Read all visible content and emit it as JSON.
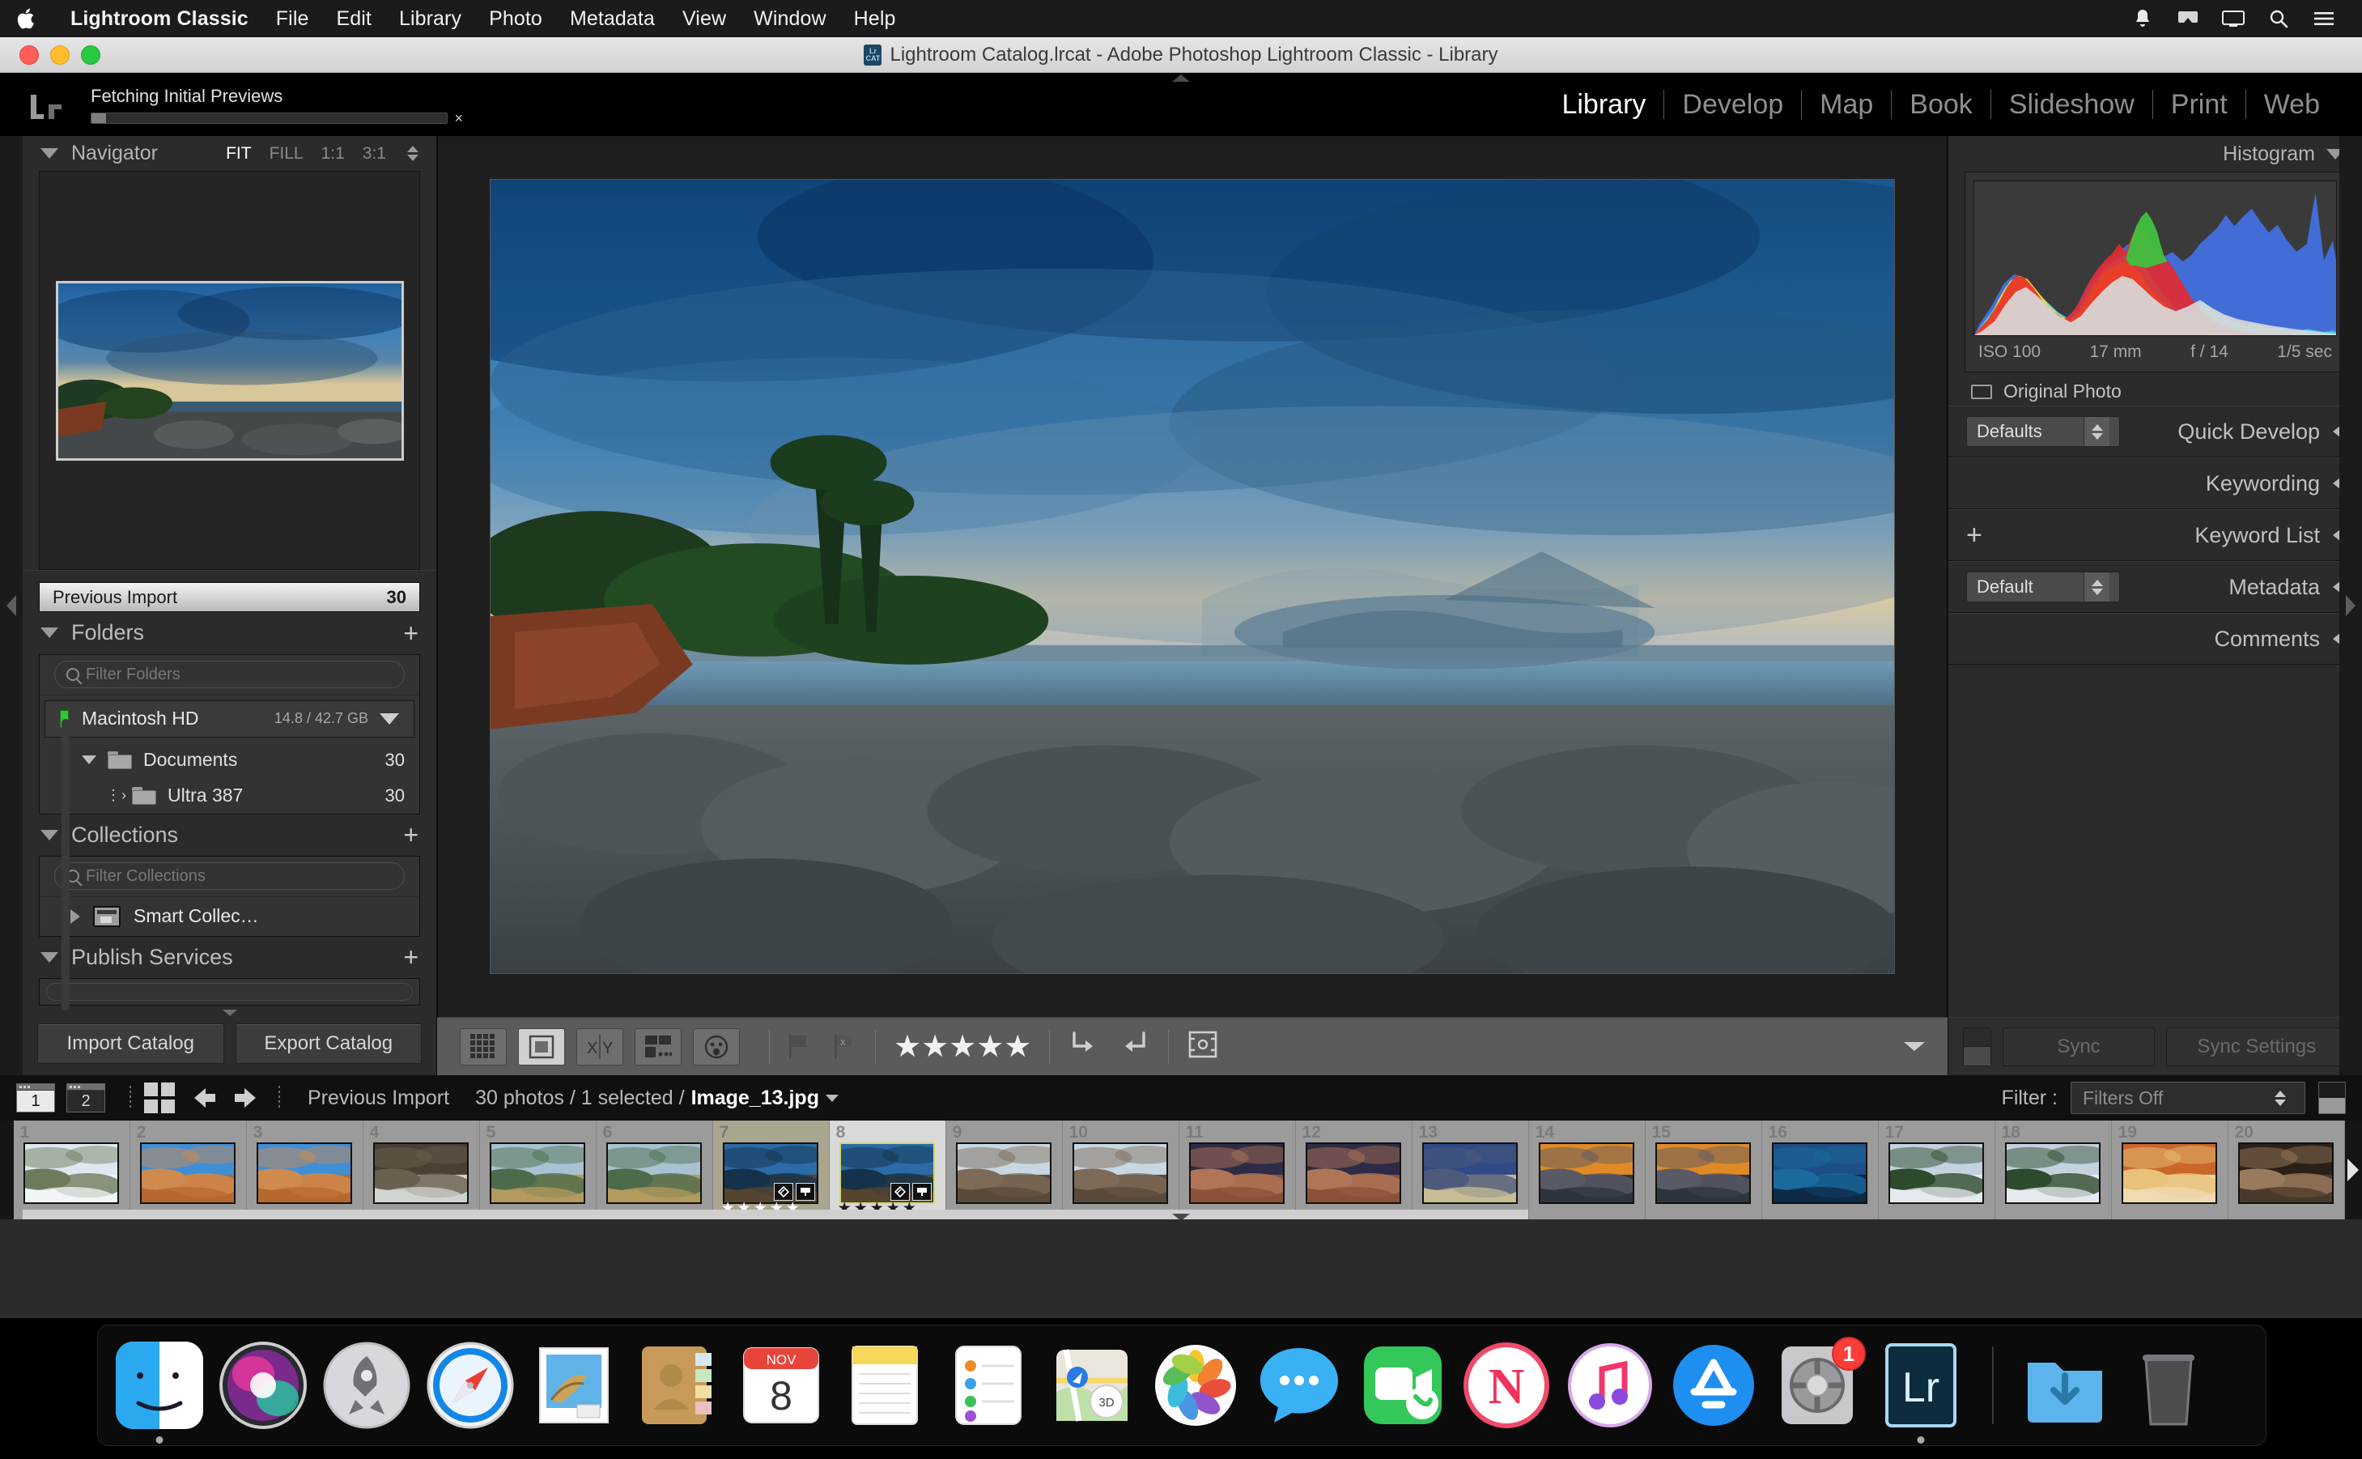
{
  "menubar": {
    "apple_icon": "apple-logo-icon",
    "items": [
      {
        "label": "Lightroom Classic",
        "bold": true
      },
      {
        "label": "File",
        "bold": false
      },
      {
        "label": "Edit",
        "bold": false
      },
      {
        "label": "Library",
        "bold": false
      },
      {
        "label": "Photo",
        "bold": false
      },
      {
        "label": "Metadata",
        "bold": false
      },
      {
        "label": "View",
        "bold": false
      },
      {
        "label": "Window",
        "bold": false
      },
      {
        "label": "Help",
        "bold": false
      }
    ],
    "status_icons": [
      "notification-bell-icon",
      "airplay-icon",
      "screen-share-icon",
      "search-icon",
      "control-center-icon"
    ]
  },
  "window": {
    "title": "Lightroom Catalog.lrcat - Adobe Photoshop Lightroom Classic - Library",
    "doc_icon_top": "Lr",
    "doc_icon_bottom": "CAT"
  },
  "topbar": {
    "app_logo": "Lr",
    "progress_label": "Fetching Initial Previews",
    "progress_percent": 4,
    "cancel_glyph": "×",
    "modules": [
      {
        "label": "Library",
        "active": true
      },
      {
        "label": "Develop",
        "active": false
      },
      {
        "label": "Map",
        "active": false
      },
      {
        "label": "Book",
        "active": false
      },
      {
        "label": "Slideshow",
        "active": false
      },
      {
        "label": "Print",
        "active": false
      },
      {
        "label": "Web",
        "active": false
      }
    ]
  },
  "left_panel": {
    "navigator": {
      "title": "Navigator",
      "zoom_levels": [
        {
          "label": "FIT",
          "active": true
        },
        {
          "label": "FILL",
          "active": false
        },
        {
          "label": "1:1",
          "active": false
        },
        {
          "label": "3:1",
          "active": false
        }
      ]
    },
    "catalog": {
      "selected_source": "Previous Import",
      "selected_count": "30"
    },
    "folders": {
      "title": "Folders",
      "add_glyph": "+",
      "filter_placeholder": "Filter Folders",
      "volume": {
        "name": "Macintosh HD",
        "space": "14.8 / 42.7 GB"
      },
      "items": [
        {
          "name": "Documents",
          "count": "30",
          "level": 1,
          "expanded": true
        },
        {
          "name": "Ultra 387",
          "count": "30",
          "level": 2,
          "expanded": false
        }
      ]
    },
    "collections": {
      "title": "Collections",
      "add_glyph": "+",
      "filter_placeholder": "Filter Collections",
      "items": [
        {
          "name": "Smart Collec…"
        }
      ]
    },
    "publish_services": {
      "title": "Publish Services",
      "add_glyph": "+"
    },
    "buttons": {
      "import": "Import Catalog",
      "export": "Export Catalog"
    }
  },
  "toolbar": {
    "view_buttons": [
      {
        "name": "grid-view-icon",
        "active": false
      },
      {
        "name": "loupe-view-icon",
        "active": true
      },
      {
        "name": "compare-view-icon",
        "active": false
      },
      {
        "name": "survey-view-icon",
        "active": false
      },
      {
        "name": "people-view-icon",
        "active": false
      }
    ],
    "flag_buttons": [
      {
        "name": "flag-pick-icon"
      },
      {
        "name": "flag-reject-icon"
      }
    ],
    "rating": {
      "stars_filled": 5,
      "star_glyph": "★"
    },
    "rotate_left": "rotate-left-icon",
    "rotate_right": "rotate-right-icon",
    "crop_overlay": "crop-overlay-icon",
    "chevron": "chevron-down-icon"
  },
  "right_panel": {
    "histogram": {
      "title": "Histogram",
      "iso": "ISO 100",
      "focal_length": "17 mm",
      "aperture": "f / 14",
      "shutter": "1/5 sec",
      "original_photo_label": "Original Photo"
    },
    "sections": [
      {
        "title": "Quick Develop",
        "select": "Defaults",
        "has_select": true,
        "has_plus": false
      },
      {
        "title": "Keywording",
        "select": "",
        "has_select": false,
        "has_plus": false
      },
      {
        "title": "Keyword List",
        "select": "",
        "has_select": false,
        "has_plus": true
      },
      {
        "title": "Metadata",
        "select": "Default",
        "has_select": true,
        "has_plus": false
      },
      {
        "title": "Comments",
        "select": "",
        "has_select": false,
        "has_plus": false
      }
    ],
    "sync": {
      "sync_label": "Sync",
      "sync_settings_label": "Sync Settings"
    }
  },
  "filmstrip_header": {
    "screen_buttons": [
      {
        "label": "1",
        "active": true
      },
      {
        "label": "2",
        "active": false
      }
    ],
    "grid_icon": "grid-toggle-icon",
    "back_icon": "navigate-back-icon",
    "forward_icon": "navigate-forward-icon",
    "source_title": "Previous Import",
    "stats": "30 photos / 1 selected /",
    "filename": "Image_13.jpg",
    "filter_label": "Filter :",
    "filter_value": "Filters Off"
  },
  "filmstrip": {
    "cells": [
      {
        "index": "1",
        "rating": "",
        "selected": "none",
        "badges": false,
        "c1": "#dfe8f0",
        "c2": "#6e7a5c",
        "c3": "#f2f4f6"
      },
      {
        "index": "2",
        "rating": "",
        "selected": "none",
        "badges": false,
        "c1": "#3f8fd6",
        "c2": "#cf8a4e",
        "c3": "#b8682f"
      },
      {
        "index": "3",
        "rating": "",
        "selected": "none",
        "badges": false,
        "c1": "#3f8fd6",
        "c2": "#cf8a4e",
        "c3": "#b8682f"
      },
      {
        "index": "4",
        "rating": "",
        "selected": "none",
        "badges": false,
        "c1": "#4a4033",
        "c2": "#6a6050",
        "c3": "#cfd4d0"
      },
      {
        "index": "5",
        "rating": "",
        "selected": "none",
        "badges": false,
        "c1": "#a9c2d2",
        "c2": "#4d6b4a",
        "c3": "#b39b5e"
      },
      {
        "index": "6",
        "rating": "",
        "selected": "none",
        "badges": false,
        "c1": "#a9c2d2",
        "c2": "#4d6b4a",
        "c3": "#b39b5e"
      },
      {
        "index": "7",
        "rating": "★★★★★",
        "selected": "other",
        "badges": true,
        "c1": "#2b6ba8",
        "c2": "#16324a",
        "c3": "#55452f"
      },
      {
        "index": "8",
        "rating": "★★★★★",
        "selected": "active",
        "badges": true,
        "c1": "#2b6ba8",
        "c2": "#16324a",
        "c3": "#55452f"
      },
      {
        "index": "9",
        "rating": "",
        "selected": "none",
        "badges": false,
        "c1": "#c8d8e2",
        "c2": "#7d6a57",
        "c3": "#5a4a3a"
      },
      {
        "index": "10",
        "rating": "",
        "selected": "none",
        "badges": false,
        "c1": "#c8d8e2",
        "c2": "#7d6a57",
        "c3": "#5a4a3a"
      },
      {
        "index": "11",
        "rating": "",
        "selected": "none",
        "badges": false,
        "c1": "#2e2b46",
        "c2": "#b07556",
        "c3": "#8a5238"
      },
      {
        "index": "12",
        "rating": "",
        "selected": "none",
        "badges": false,
        "c1": "#2e2b46",
        "c2": "#b07556",
        "c3": "#8a5238"
      },
      {
        "index": "13",
        "rating": "",
        "selected": "none",
        "badges": false,
        "c1": "#2f4a86",
        "c2": "#4e5a7a",
        "c3": "#c6bd95"
      },
      {
        "index": "14",
        "rating": "",
        "selected": "none",
        "badges": false,
        "c1": "#e08a26",
        "c2": "#5a5a66",
        "c3": "#2e3440"
      },
      {
        "index": "15",
        "rating": "",
        "selected": "none",
        "badges": false,
        "c1": "#e08a26",
        "c2": "#5a5a66",
        "c3": "#2e3440"
      },
      {
        "index": "16",
        "rating": "",
        "selected": "none",
        "badges": false,
        "c1": "#1d4f86",
        "c2": "#1a6a9e",
        "c3": "#0d2a46"
      },
      {
        "index": "17",
        "rating": "",
        "selected": "none",
        "badges": false,
        "c1": "#c3d2de",
        "c2": "#2d4a2c",
        "c3": "#e6eaee"
      },
      {
        "index": "18",
        "rating": "",
        "selected": "none",
        "badges": false,
        "c1": "#c3d2de",
        "c2": "#2d4a2c",
        "c3": "#e6eaee"
      },
      {
        "index": "19",
        "rating": "",
        "selected": "none",
        "badges": false,
        "c1": "#c9662a",
        "c2": "#e8c27a",
        "c3": "#f0d9b0"
      },
      {
        "index": "20",
        "rating": "",
        "selected": "none",
        "badges": false,
        "c1": "#2a2018",
        "c2": "#9a7a5c",
        "c3": "#4a3a2a"
      }
    ],
    "badge_icons": [
      "crop-badge-icon",
      "develop-badge-icon"
    ]
  },
  "dock": {
    "items": [
      {
        "name": "finder-icon",
        "running": true
      },
      {
        "name": "siri-icon",
        "running": false
      },
      {
        "name": "launchpad-icon",
        "running": false
      },
      {
        "name": "safari-icon",
        "running": false
      },
      {
        "name": "mail-icon",
        "running": false
      },
      {
        "name": "contacts-icon",
        "running": false
      },
      {
        "name": "calendar-icon",
        "running": false,
        "month": "NOV",
        "day": "8"
      },
      {
        "name": "notes-icon",
        "running": false
      },
      {
        "name": "reminders-icon",
        "running": false
      },
      {
        "name": "maps-icon",
        "running": false
      },
      {
        "name": "photos-icon",
        "running": false
      },
      {
        "name": "messages-icon",
        "running": false
      },
      {
        "name": "facetime-icon",
        "running": false
      },
      {
        "name": "news-icon",
        "running": false
      },
      {
        "name": "itunes-icon",
        "running": false
      },
      {
        "name": "app-store-icon",
        "running": false
      },
      {
        "name": "system-preferences-icon",
        "running": false,
        "badge": "1"
      },
      {
        "name": "lightroom-classic-icon",
        "running": true,
        "label": "Lr"
      },
      {
        "name": "downloads-folder-icon",
        "running": false
      },
      {
        "name": "trash-icon",
        "running": false
      }
    ]
  },
  "colors": {
    "accent_yellow": "#d2d86a",
    "panel_bg": "#2b2b2b",
    "app_bg": "#1b1b1b",
    "filmstrip_bg": "#9b9b9b",
    "volume_led_green": "#35c13b"
  }
}
